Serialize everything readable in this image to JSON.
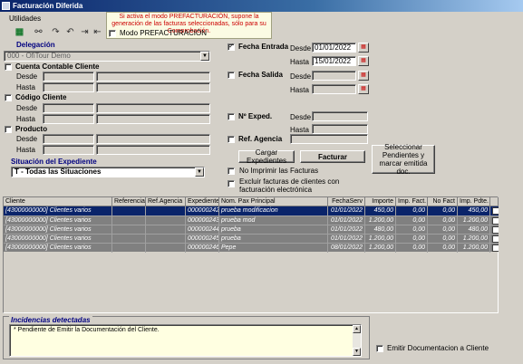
{
  "window": {
    "title": "Facturación Diferida"
  },
  "menu": {
    "utilidades": "Utilidades"
  },
  "toolbar": {
    "icons": [
      "excel-icon",
      "binoculars-icon",
      "redo-icon",
      "undo-icon",
      "forward-all-icon",
      "back-all-icon"
    ]
  },
  "tooltip": {
    "text": "Si activa el modo PREFACTURACIÓN, supone la generación de las facturas seleccionadas, sólo para su Comprobación."
  },
  "prefact": {
    "label": "Modo PREFACTURACIÓN",
    "checked": false
  },
  "delegacion": {
    "label": "Delegación",
    "value": "000 - OfiTour Demo"
  },
  "cuenta": {
    "label": "Cuenta Contable Cliente",
    "desde": "Desde",
    "hasta": "Hasta"
  },
  "codigo": {
    "label": "Código Cliente",
    "desde": "Desde",
    "hasta": "Hasta"
  },
  "producto": {
    "label": "Producto",
    "desde": "Desde",
    "hasta": "Hasta"
  },
  "situacion": {
    "label": "Situación del Expediente",
    "value": "T - Todas las Situaciones"
  },
  "fecha_entrada": {
    "label": "Fecha Entrada",
    "checked": true,
    "desde_label": "Desde",
    "hasta_label": "Hasta",
    "desde": "01/01/2022",
    "hasta": "15/01/2022"
  },
  "fecha_salida": {
    "label": "Fecha Salida",
    "checked": false,
    "desde_label": "Desde",
    "hasta_label": "Hasta"
  },
  "expediente": {
    "label": "Nº Exped.",
    "checked": false,
    "desde_label": "Desde",
    "hasta_label": "Hasta"
  },
  "agencia": {
    "label": "Ref. Agencia",
    "checked": false
  },
  "buttons": {
    "cargar": "Cargar Expedientes",
    "facturar": "Facturar",
    "seleccionar": "Seleccionar Pendientes y marcar emitida doc."
  },
  "no_imprimir": {
    "label": "No Imprimir las Facturas",
    "checked": false
  },
  "excluir": {
    "label": "Excluir facturas de clientes con facturación electrónica",
    "checked": false
  },
  "grid": {
    "columns": [
      "Cliente",
      "Referencia",
      "Ref.Agencia",
      "Expediente",
      "Nom. Pax Principal",
      "FechaServ",
      "Importe",
      "Imp. Fact.",
      "No Fact",
      "Imp. Pdte."
    ],
    "rows": [
      {
        "cliente": "[43000000000] Clientes varios",
        "referencia": "",
        "ref_agencia": "",
        "expediente": "000000242",
        "pax": "prueba modificacion",
        "fecha": "01/01/2022",
        "importe": "450,00",
        "imp_fact": "0,00",
        "no_fact": "0,00",
        "pdte": "450,00",
        "selected": true
      },
      {
        "cliente": "[43000000000] Clientes varios",
        "referencia": "",
        "ref_agencia": "",
        "expediente": "000000243",
        "pax": "prueba mod",
        "fecha": "01/01/2022",
        "importe": "1.200,00",
        "imp_fact": "0,00",
        "no_fact": "0,00",
        "pdte": "1.200,00",
        "selected": false
      },
      {
        "cliente": "[43000000000] Clientes varios",
        "referencia": "",
        "ref_agencia": "",
        "expediente": "000000244",
        "pax": "prueba",
        "fecha": "01/01/2022",
        "importe": "480,00",
        "imp_fact": "0,00",
        "no_fact": "0,00",
        "pdte": "480,00",
        "selected": false
      },
      {
        "cliente": "[43000000000] Clientes varios",
        "referencia": "",
        "ref_agencia": "",
        "expediente": "000000245",
        "pax": "prueba",
        "fecha": "01/01/2022",
        "importe": "1.200,00",
        "imp_fact": "0,00",
        "no_fact": "0,00",
        "pdte": "1.200,00",
        "selected": false
      },
      {
        "cliente": "[43000000000] Clientes varios",
        "referencia": "",
        "ref_agencia": "",
        "expediente": "000000246",
        "pax": "Pepe",
        "fecha": "08/01/2022",
        "importe": "1.200,00",
        "imp_fact": "0,00",
        "no_fact": "0,00",
        "pdte": "1.200,00",
        "selected": false
      }
    ]
  },
  "incidencias": {
    "title": "Incidencias detectadas",
    "text": "* Pendiente de Emitir la Documentación del Cliente."
  },
  "emitir": {
    "label": "Emitir Documentacion a Cliente",
    "checked": false
  }
}
